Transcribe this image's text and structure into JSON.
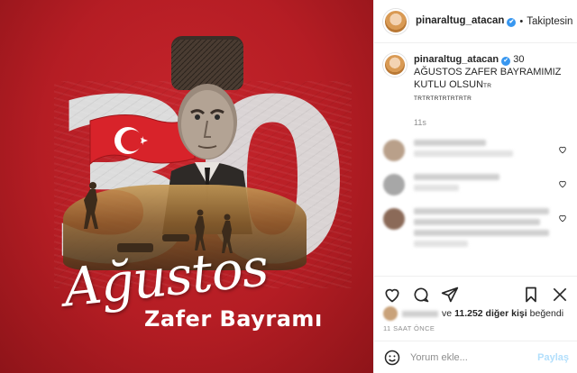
{
  "post_image": {
    "number_left": "3",
    "number_right": "0",
    "script_text": "Ağustos",
    "title_text": "Zafer Bayramı"
  },
  "header": {
    "username": "pinaraltug_atacan",
    "separator": "•",
    "follow_status": "Takiptesin",
    "verified_glyph": "✔"
  },
  "caption": {
    "username": "pinaraltug_atacan",
    "text": "30 AĞUSTOS ZAFER BAYRAMIMIZ KUTLU OLSUN",
    "suffix_small": "TR",
    "trailing_small": "TRTRTRTRTRTRTR",
    "timestamp": "11s"
  },
  "comments": [
    {
      "avatar_color": "#b9a08a",
      "lines": 2
    },
    {
      "avatar_color": "#a7a7a7",
      "lines": 2
    },
    {
      "avatar_color": "#8b6a58",
      "lines": 4
    }
  ],
  "actions": {
    "icons": [
      "heart-icon",
      "comment-icon",
      "share-icon",
      "bookmark-icon",
      "report-icon"
    ]
  },
  "likes": {
    "prefix": "ve",
    "count": "11.252 diğer kişi",
    "suffix": "beğendi"
  },
  "time_ago": "11 SAAT ÖNCE",
  "comment_box": {
    "placeholder": "Yorum ekle...",
    "post_label": "Paylaş"
  },
  "colors": {
    "background_red": "#b51d24",
    "verified_blue": "#3897f0",
    "post_button_disabled": "#b2dffc"
  }
}
